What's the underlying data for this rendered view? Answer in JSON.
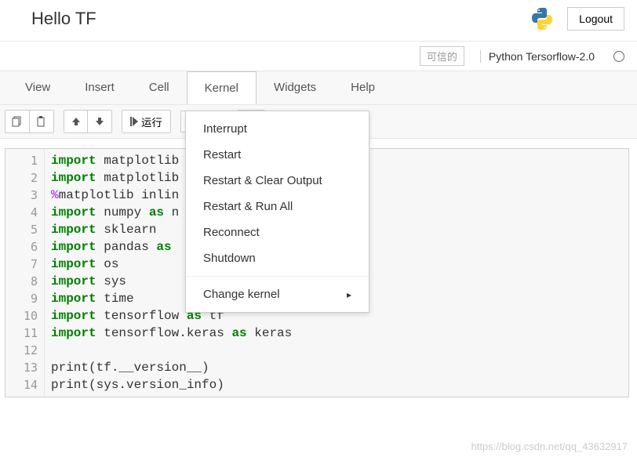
{
  "header": {
    "title": "Hello TF",
    "logout": "Logout"
  },
  "kernelRow": {
    "trusted": "可信的",
    "kernelName": "Python Tersorflow-2.0"
  },
  "menu": {
    "items": [
      "View",
      "Insert",
      "Cell",
      "Kernel",
      "Widgets",
      "Help"
    ],
    "openIndex": 3
  },
  "toolbar": {
    "runLabel": "运行"
  },
  "dropdown": {
    "items": [
      "Interrupt",
      "Restart",
      "Restart & Clear Output",
      "Restart & Run All",
      "Reconnect",
      "Shutdown"
    ],
    "submenu": "Change kernel"
  },
  "code": {
    "lines": [
      {
        "n": "1",
        "t": [
          {
            "c": "kw",
            "s": "import"
          },
          {
            "s": " matplotlib"
          }
        ]
      },
      {
        "n": "2",
        "t": [
          {
            "c": "kw",
            "s": "import"
          },
          {
            "s": " matplotlib"
          }
        ]
      },
      {
        "n": "3",
        "t": [
          {
            "c": "mg",
            "s": "%"
          },
          {
            "s": "matplotlib inlin"
          }
        ]
      },
      {
        "n": "4",
        "t": [
          {
            "c": "kw",
            "s": "import"
          },
          {
            "s": " numpy "
          },
          {
            "c": "kw",
            "s": "as"
          },
          {
            "s": " n"
          }
        ]
      },
      {
        "n": "5",
        "t": [
          {
            "c": "kw",
            "s": "import"
          },
          {
            "s": " sklearn"
          }
        ]
      },
      {
        "n": "6",
        "t": [
          {
            "c": "kw",
            "s": "import"
          },
          {
            "s": " pandas "
          },
          {
            "c": "kw",
            "s": "as"
          }
        ]
      },
      {
        "n": "7",
        "t": [
          {
            "c": "kw",
            "s": "import"
          },
          {
            "s": " os"
          }
        ]
      },
      {
        "n": "8",
        "t": [
          {
            "c": "kw",
            "s": "import"
          },
          {
            "s": " sys"
          }
        ]
      },
      {
        "n": "9",
        "t": [
          {
            "c": "kw",
            "s": "import"
          },
          {
            "s": " time"
          }
        ]
      },
      {
        "n": "10",
        "t": [
          {
            "c": "kw",
            "s": "import"
          },
          {
            "s": " tensorflow "
          },
          {
            "c": "kw",
            "s": "as"
          },
          {
            "s": " tf"
          }
        ]
      },
      {
        "n": "11",
        "t": [
          {
            "c": "kw",
            "s": "import"
          },
          {
            "s": " tensorflow.keras "
          },
          {
            "c": "kw",
            "s": "as"
          },
          {
            "s": " keras"
          }
        ]
      },
      {
        "n": "12",
        "t": []
      },
      {
        "n": "13",
        "t": [
          {
            "s": "print(tf.__version__)"
          }
        ]
      },
      {
        "n": "14",
        "t": [
          {
            "s": "print(sys.version_info)"
          }
        ]
      }
    ]
  },
  "watermark": "https://blog.csdn.net/qq_43632917"
}
